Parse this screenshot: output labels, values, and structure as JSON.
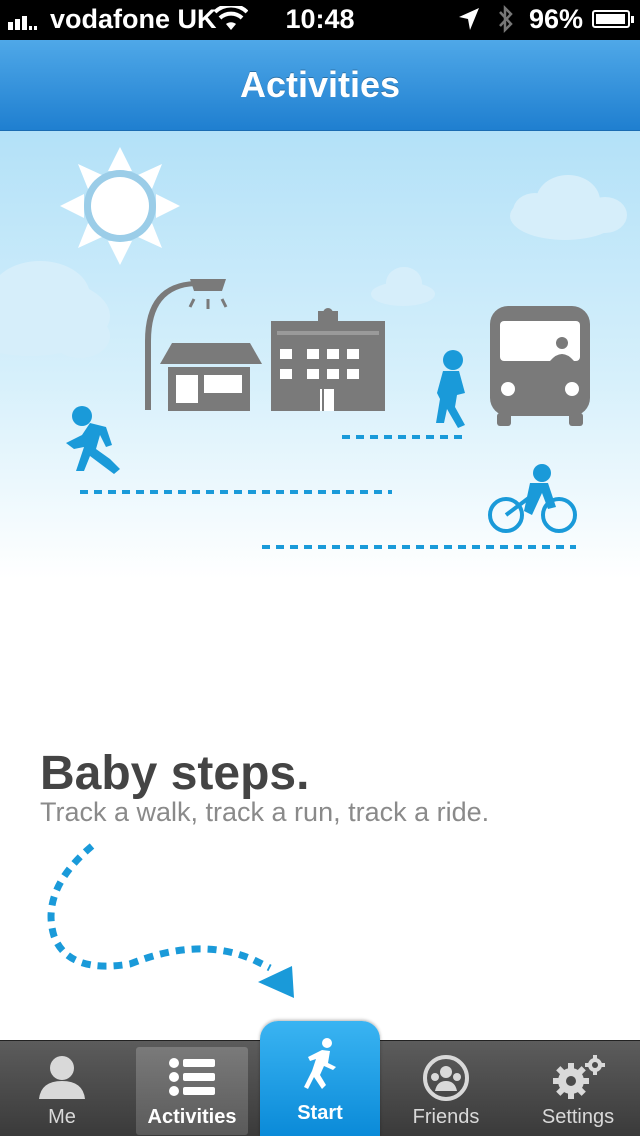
{
  "status_bar": {
    "carrier": "vodafone UK",
    "time": "10:48",
    "battery_percent": "96%",
    "battery_level": 0.96
  },
  "nav": {
    "title": "Activities"
  },
  "onboarding": {
    "headline": "Baby steps.",
    "subline": "Track a walk, track a run, track a ride."
  },
  "tabs": {
    "me": "Me",
    "activities": "Activities",
    "start": "Start",
    "friends": "Friends",
    "settings": "Settings"
  },
  "colors": {
    "accent": "#1a9ad9",
    "nav_blue": "#2b8ee0",
    "building_gray": "#7a7a7a",
    "tab_bar": "#474747"
  },
  "icons": {
    "me": "person-silhouette-icon",
    "activities": "list-icon",
    "start": "runner-icon",
    "friends": "friends-group-icon",
    "settings": "gears-icon"
  }
}
